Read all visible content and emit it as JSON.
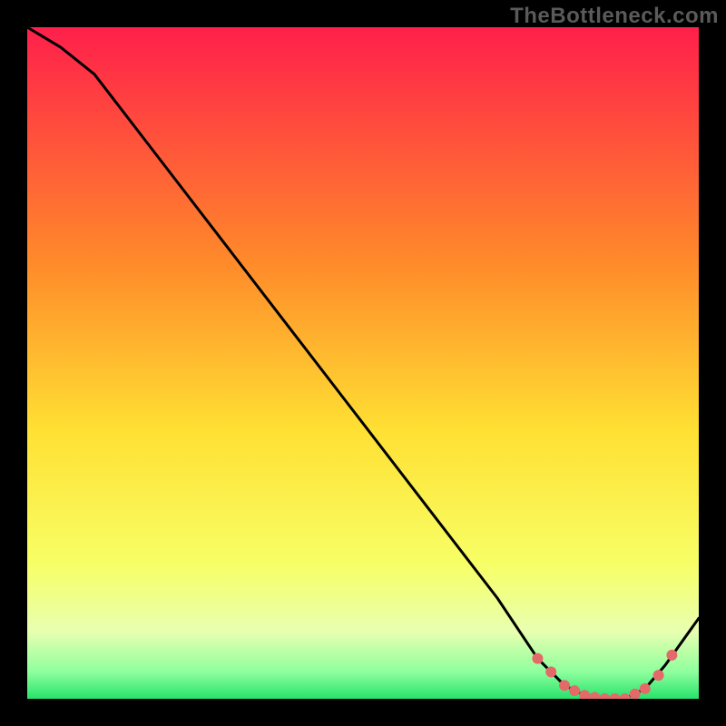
{
  "watermark": "TheBottleneck.com",
  "colors": {
    "page_bg": "#000000",
    "grad_top": "#ff1f4b",
    "grad_mid1": "#ff8a2a",
    "grad_mid2": "#ffe033",
    "grad_mid3": "#f7ff66",
    "grad_bottom": "#27e36b",
    "line": "#000000",
    "marker": "#e46a6a",
    "watermark_text": "#5a5a5a"
  },
  "chart_data": {
    "type": "line",
    "title": "",
    "xlabel": "",
    "ylabel": "",
    "xlim": [
      0,
      100
    ],
    "ylim": [
      0,
      100
    ],
    "series": [
      {
        "name": "bottleneck-curve",
        "x": [
          0,
          5,
          10,
          20,
          30,
          40,
          50,
          60,
          70,
          76,
          80,
          83,
          86,
          89,
          92,
          95,
          100
        ],
        "values": [
          100,
          97,
          93,
          80,
          67,
          54,
          41,
          28,
          15,
          6,
          2,
          0.5,
          0,
          0,
          1.5,
          5,
          12
        ]
      }
    ],
    "markers": {
      "name": "highlighted-range",
      "x": [
        76,
        78,
        80,
        81.5,
        83,
        84.5,
        86,
        87.5,
        89,
        90.5,
        92,
        94,
        96
      ],
      "values": [
        6,
        4,
        2,
        1.2,
        0.5,
        0.2,
        0,
        0,
        0,
        0.7,
        1.5,
        3.5,
        6.5
      ]
    },
    "gradient_stops": [
      {
        "offset": 0.0,
        "color": "#ff1f4b"
      },
      {
        "offset": 0.35,
        "color": "#ff8a2a"
      },
      {
        "offset": 0.6,
        "color": "#ffe033"
      },
      {
        "offset": 0.8,
        "color": "#f7ff66"
      },
      {
        "offset": 0.9,
        "color": "#e8ffb0"
      },
      {
        "offset": 0.96,
        "color": "#8eff9d"
      },
      {
        "offset": 1.0,
        "color": "#27e36b"
      }
    ]
  }
}
